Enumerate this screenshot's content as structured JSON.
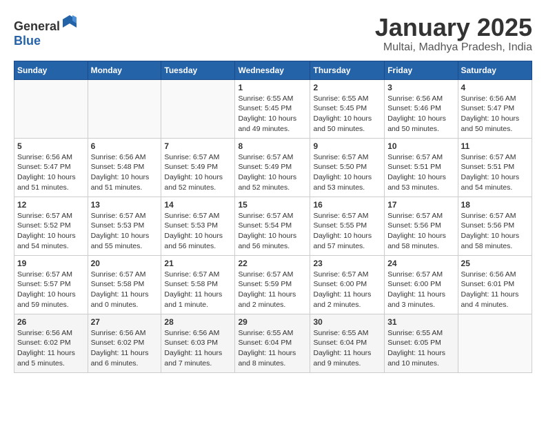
{
  "header": {
    "logo_general": "General",
    "logo_blue": "Blue",
    "month_title": "January 2025",
    "location": "Multai, Madhya Pradesh, India"
  },
  "days_of_week": [
    "Sunday",
    "Monday",
    "Tuesday",
    "Wednesday",
    "Thursday",
    "Friday",
    "Saturday"
  ],
  "weeks": [
    [
      {
        "day": "",
        "info": ""
      },
      {
        "day": "",
        "info": ""
      },
      {
        "day": "",
        "info": ""
      },
      {
        "day": "1",
        "info": "Sunrise: 6:55 AM\nSunset: 5:45 PM\nDaylight: 10 hours\nand 49 minutes."
      },
      {
        "day": "2",
        "info": "Sunrise: 6:55 AM\nSunset: 5:45 PM\nDaylight: 10 hours\nand 50 minutes."
      },
      {
        "day": "3",
        "info": "Sunrise: 6:56 AM\nSunset: 5:46 PM\nDaylight: 10 hours\nand 50 minutes."
      },
      {
        "day": "4",
        "info": "Sunrise: 6:56 AM\nSunset: 5:47 PM\nDaylight: 10 hours\nand 50 minutes."
      }
    ],
    [
      {
        "day": "5",
        "info": "Sunrise: 6:56 AM\nSunset: 5:47 PM\nDaylight: 10 hours\nand 51 minutes."
      },
      {
        "day": "6",
        "info": "Sunrise: 6:56 AM\nSunset: 5:48 PM\nDaylight: 10 hours\nand 51 minutes."
      },
      {
        "day": "7",
        "info": "Sunrise: 6:57 AM\nSunset: 5:49 PM\nDaylight: 10 hours\nand 52 minutes."
      },
      {
        "day": "8",
        "info": "Sunrise: 6:57 AM\nSunset: 5:49 PM\nDaylight: 10 hours\nand 52 minutes."
      },
      {
        "day": "9",
        "info": "Sunrise: 6:57 AM\nSunset: 5:50 PM\nDaylight: 10 hours\nand 53 minutes."
      },
      {
        "day": "10",
        "info": "Sunrise: 6:57 AM\nSunset: 5:51 PM\nDaylight: 10 hours\nand 53 minutes."
      },
      {
        "day": "11",
        "info": "Sunrise: 6:57 AM\nSunset: 5:51 PM\nDaylight: 10 hours\nand 54 minutes."
      }
    ],
    [
      {
        "day": "12",
        "info": "Sunrise: 6:57 AM\nSunset: 5:52 PM\nDaylight: 10 hours\nand 54 minutes."
      },
      {
        "day": "13",
        "info": "Sunrise: 6:57 AM\nSunset: 5:53 PM\nDaylight: 10 hours\nand 55 minutes."
      },
      {
        "day": "14",
        "info": "Sunrise: 6:57 AM\nSunset: 5:53 PM\nDaylight: 10 hours\nand 56 minutes."
      },
      {
        "day": "15",
        "info": "Sunrise: 6:57 AM\nSunset: 5:54 PM\nDaylight: 10 hours\nand 56 minutes."
      },
      {
        "day": "16",
        "info": "Sunrise: 6:57 AM\nSunset: 5:55 PM\nDaylight: 10 hours\nand 57 minutes."
      },
      {
        "day": "17",
        "info": "Sunrise: 6:57 AM\nSunset: 5:56 PM\nDaylight: 10 hours\nand 58 minutes."
      },
      {
        "day": "18",
        "info": "Sunrise: 6:57 AM\nSunset: 5:56 PM\nDaylight: 10 hours\nand 58 minutes."
      }
    ],
    [
      {
        "day": "19",
        "info": "Sunrise: 6:57 AM\nSunset: 5:57 PM\nDaylight: 10 hours\nand 59 minutes."
      },
      {
        "day": "20",
        "info": "Sunrise: 6:57 AM\nSunset: 5:58 PM\nDaylight: 11 hours\nand 0 minutes."
      },
      {
        "day": "21",
        "info": "Sunrise: 6:57 AM\nSunset: 5:58 PM\nDaylight: 11 hours\nand 1 minute."
      },
      {
        "day": "22",
        "info": "Sunrise: 6:57 AM\nSunset: 5:59 PM\nDaylight: 11 hours\nand 2 minutes."
      },
      {
        "day": "23",
        "info": "Sunrise: 6:57 AM\nSunset: 6:00 PM\nDaylight: 11 hours\nand 2 minutes."
      },
      {
        "day": "24",
        "info": "Sunrise: 6:57 AM\nSunset: 6:00 PM\nDaylight: 11 hours\nand 3 minutes."
      },
      {
        "day": "25",
        "info": "Sunrise: 6:56 AM\nSunset: 6:01 PM\nDaylight: 11 hours\nand 4 minutes."
      }
    ],
    [
      {
        "day": "26",
        "info": "Sunrise: 6:56 AM\nSunset: 6:02 PM\nDaylight: 11 hours\nand 5 minutes."
      },
      {
        "day": "27",
        "info": "Sunrise: 6:56 AM\nSunset: 6:02 PM\nDaylight: 11 hours\nand 6 minutes."
      },
      {
        "day": "28",
        "info": "Sunrise: 6:56 AM\nSunset: 6:03 PM\nDaylight: 11 hours\nand 7 minutes."
      },
      {
        "day": "29",
        "info": "Sunrise: 6:55 AM\nSunset: 6:04 PM\nDaylight: 11 hours\nand 8 minutes."
      },
      {
        "day": "30",
        "info": "Sunrise: 6:55 AM\nSunset: 6:04 PM\nDaylight: 11 hours\nand 9 minutes."
      },
      {
        "day": "31",
        "info": "Sunrise: 6:55 AM\nSunset: 6:05 PM\nDaylight: 11 hours\nand 10 minutes."
      },
      {
        "day": "",
        "info": ""
      }
    ]
  ]
}
